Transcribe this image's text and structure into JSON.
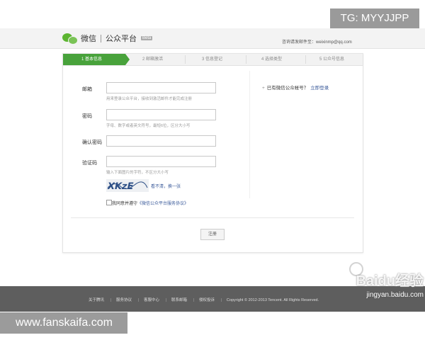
{
  "header": {
    "logo_main": "微信",
    "logo_sub": "公众平台",
    "beta": "Beta",
    "help_text": "咨询请发邮件至：weixinmp@qq.com"
  },
  "steps": [
    {
      "label": "1 基本信息",
      "active": true
    },
    {
      "label": "2 邮箱激活",
      "active": false
    },
    {
      "label": "3 信息登记",
      "active": false
    },
    {
      "label": "4 选择类型",
      "active": false
    },
    {
      "label": "5 公众号信息",
      "active": false
    }
  ],
  "form": {
    "email_label": "邮箱",
    "email_value": "",
    "email_hint": "用来登录公众平台，接收到激活邮件才能完成注册",
    "password_label": "密码",
    "password_value": "",
    "password_hint": "字母、数字或者英文符号，最短6位，区分大小写",
    "confirm_label": "确认密码",
    "confirm_value": "",
    "captcha_label": "验证码",
    "captcha_value": "",
    "captcha_hint": "输入下面图片的字符，不区分大小写",
    "captcha_text": "XKzE",
    "captcha_refresh": "看不清，换一张",
    "agree_prefix": "我同意并遵守",
    "agree_link": "《微信公众平台服务协议》",
    "register_button": "注册"
  },
  "side": {
    "plus": "+",
    "has_account": "已有微信公众帐号？",
    "login_link": "立即登录"
  },
  "footer": {
    "links": [
      "关于腾讯",
      "服务协议",
      "客服中心",
      "联系邮箱",
      "侵权投诉"
    ],
    "copyright": "Copyright © 2012-2013 Tencent. All Rights Reserved."
  },
  "watermarks": {
    "tg": "TG: MYYJJPP",
    "fans": "www.fanskaifa.com",
    "baidu": "Baidu经验",
    "baidu_url": "jingyan.baidu.com"
  },
  "colors": {
    "accent": "#48a23b",
    "link": "#3a5a9a",
    "footer": "#5e5e5e"
  }
}
